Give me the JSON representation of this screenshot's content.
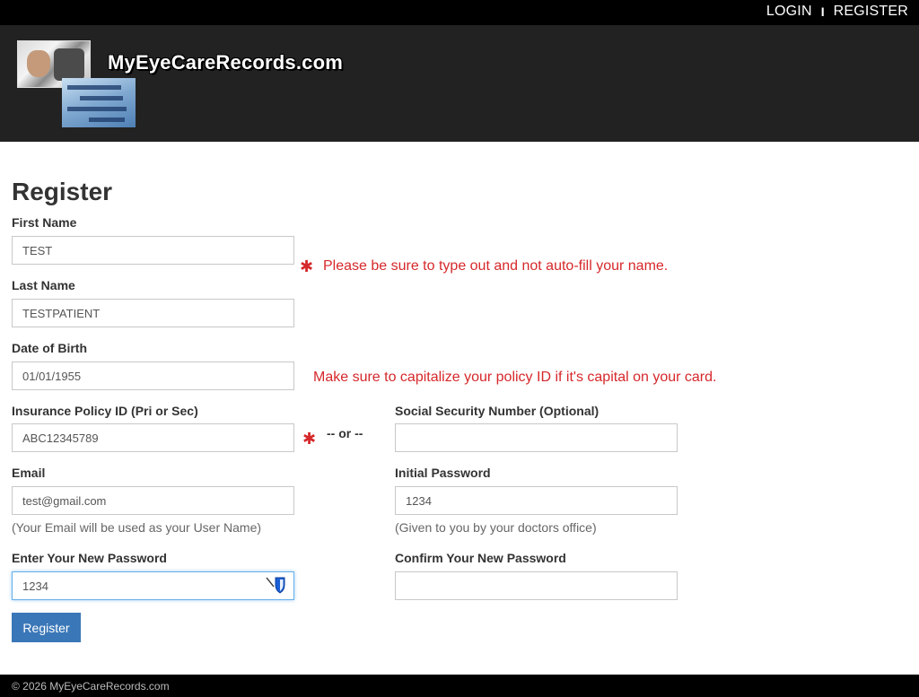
{
  "topnav": {
    "login": "LOGIN",
    "separator": "I",
    "register": "REGISTER"
  },
  "header": {
    "site_title": "MyEyeCareRecords.com"
  },
  "form": {
    "title": "Register",
    "first_name": {
      "label": "First Name",
      "value": "TEST"
    },
    "last_name": {
      "label": "Last Name",
      "value": "TESTPATIENT"
    },
    "dob": {
      "label": "Date of Birth",
      "value": "01/01/1955"
    },
    "policy_id": {
      "label": "Insurance Policy ID (Pri or Sec)",
      "value": "ABC12345789"
    },
    "or_text": "-- or --",
    "ssn": {
      "label": "Social Security Number (Optional)",
      "value": ""
    },
    "email": {
      "label": "Email",
      "value": "test@gmail.com",
      "help": "(Your Email will be used as your User Name)"
    },
    "initial_password": {
      "label": "Initial Password",
      "value": "1234",
      "help": "(Given to you by your doctors office)"
    },
    "new_password": {
      "label": "Enter Your New Password",
      "value": "1234"
    },
    "confirm_password": {
      "label": "Confirm Your New Password",
      "value": ""
    },
    "submit_label": "Register"
  },
  "notes": {
    "name_note": "Please be sure to type out and not auto-fill your name.",
    "policy_note": "Make sure to capitalize your policy ID if it's capital on your card."
  },
  "icons": {
    "required": "asterisk-icon",
    "password_manager": "password-manager-shield-icon"
  },
  "colors": {
    "accent": "#3a77b8",
    "note": "#d6282b",
    "header_bg": "#222222",
    "topbar_bg": "#000000"
  },
  "footer": {
    "text": "© 2026 MyEyeCareRecords.com"
  }
}
